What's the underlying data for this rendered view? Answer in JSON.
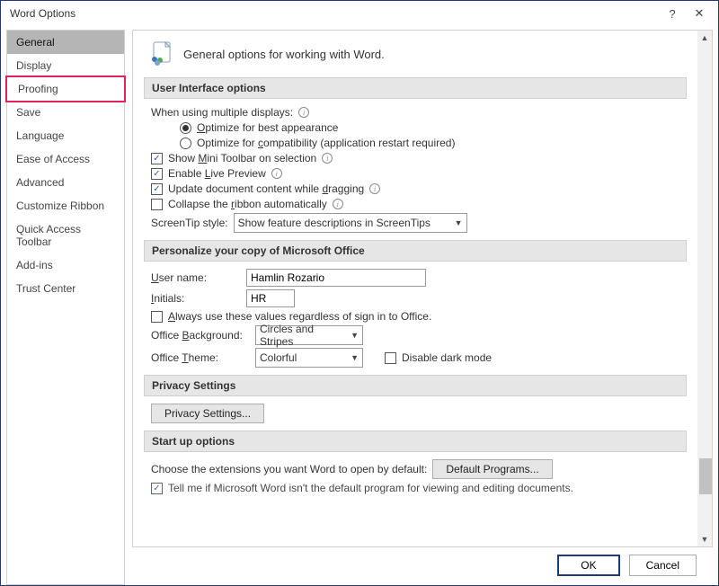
{
  "title": "Word Options",
  "sidebar": {
    "items": [
      {
        "label": "General",
        "selected": true
      },
      {
        "label": "Display"
      },
      {
        "label": "Proofing",
        "highlighted": true
      },
      {
        "label": "Save"
      },
      {
        "label": "Language"
      },
      {
        "label": "Ease of Access"
      },
      {
        "label": "Advanced"
      },
      {
        "label": "Customize Ribbon"
      },
      {
        "label": "Quick Access Toolbar"
      },
      {
        "label": "Add-ins"
      },
      {
        "label": "Trust Center"
      }
    ]
  },
  "header": "General options for working with Word.",
  "groups": {
    "ui": {
      "title": "User Interface options",
      "multi_displays_label": "When using multiple displays:",
      "radio_best": "Optimize for best appearance",
      "radio_compat": "Optimize for compatibility (application restart required)",
      "radio_selected": "best",
      "show_mini_toolbar": {
        "label": "Show Mini Toolbar on selection",
        "checked": true
      },
      "enable_live_preview": {
        "label": "Enable Live Preview",
        "checked": true
      },
      "update_while_dragging": {
        "label": "Update document content while dragging",
        "checked": true
      },
      "collapse_ribbon": {
        "label": "Collapse the ribbon automatically",
        "checked": false
      },
      "screentip_label": "ScreenTip style:",
      "screentip_value": "Show feature descriptions in ScreenTips"
    },
    "personalize": {
      "title": "Personalize your copy of Microsoft Office",
      "username_label": "User name:",
      "username_value": "Hamlin Rozario",
      "initials_label": "Initials:",
      "initials_value": "HR",
      "always_use": {
        "label": "Always use these values regardless of sign in to Office.",
        "checked": false
      },
      "bg_label": "Office Background:",
      "bg_value": "Circles and Stripes",
      "theme_label": "Office Theme:",
      "theme_value": "Colorful",
      "disable_dark": {
        "label": "Disable dark mode",
        "checked": false
      }
    },
    "privacy": {
      "title": "Privacy Settings",
      "button": "Privacy Settings..."
    },
    "startup": {
      "title": "Start up options",
      "extensions_label": "Choose the extensions you want Word to open by default:",
      "default_programs_btn": "Default Programs...",
      "tell_me": {
        "label": "Tell me if Microsoft Word isn't the default program for viewing and editing documents.",
        "checked": true
      }
    }
  },
  "footer": {
    "ok": "OK",
    "cancel": "Cancel"
  }
}
